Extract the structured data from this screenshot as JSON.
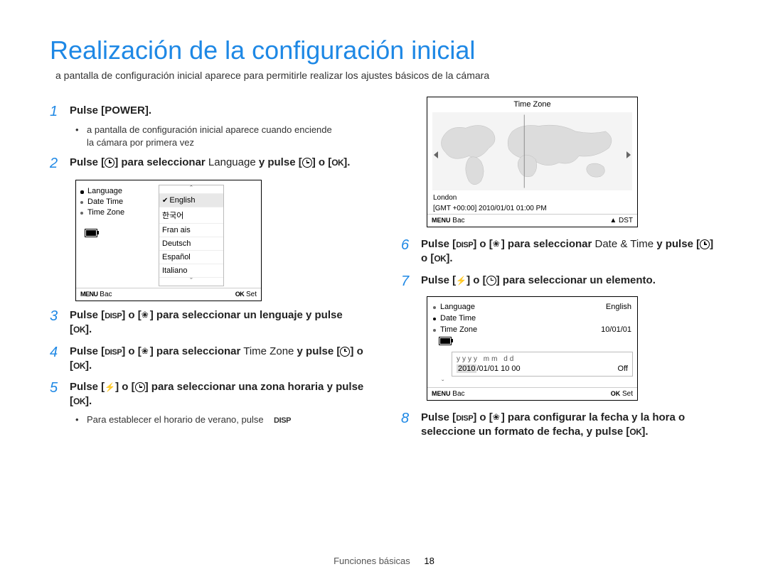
{
  "header": {
    "title": "Realización de la configuración inicial",
    "subtitle": "a pantalla de configuración inicial aparece para permitirle realizar los ajustes básicos de la cámara"
  },
  "steps": {
    "s1": {
      "pre": "Pulse [",
      "power": "POWER",
      "post": "].",
      "bullet_a": "a pantalla de configuración inicial aparece cuando enciende",
      "bullet_b": "la cámara por primera vez"
    },
    "s2": {
      "p1": "Pulse [",
      "p2": "] para seleccionar",
      "lang": " Language ",
      "p3": "y pulse [",
      "p4": "] o [",
      "p5": "]."
    },
    "s3": {
      "p1": "Pulse [",
      "p2": "] o [",
      "p3": "] para seleccionar un lenguaje y pulse [",
      "p4": "]."
    },
    "s4": {
      "p1": "Pulse [",
      "p2": "] o [",
      "p3": "] para seleccionar",
      "tz": " Time Zone ",
      "p4": "y pulse [",
      "p5": "] o [",
      "p6": "]."
    },
    "s5": {
      "p1": "Pulse [",
      "p2": "] o [",
      "p3": "] para seleccionar una zona horaria y pulse [",
      "p4": "].",
      "bullet": "Para establecer el horario de verano, pulse"
    },
    "s6": {
      "p1": "Pulse [",
      "p2": "] o [",
      "p3": "] para seleccionar",
      "dt": " Date & Time ",
      "p4": "y pulse [",
      "p5": "] o [",
      "p6": "]."
    },
    "s7": {
      "p1": "Pulse [",
      "p2": "] o [",
      "p3": "] para seleccionar un elemento."
    },
    "s8": {
      "p1": "Pulse [",
      "p2": "] o [",
      "p3": "] para configurar la fecha y la hora o seleccione un formato de fecha, y pulse [",
      "p4": "]."
    }
  },
  "glyphs": {
    "disp": "DISP",
    "ok": "OK",
    "menu": "MENU",
    "up": "▲",
    "dn": "▼"
  },
  "lcd_lang": {
    "left": {
      "item1": "Language",
      "item2": "Date   Time",
      "item3": "Time Zone"
    },
    "list": {
      "l1": "English",
      "l2": "한국어",
      "l3": "Fran ais",
      "l4": "Deutsch",
      "l5": "Español",
      "l6": "Italiano"
    },
    "bar_back": "Bac",
    "bar_set": "Set"
  },
  "lcd_tz": {
    "title": "Time Zone",
    "city": "London",
    "stamp": "[GMT +00:00] 2010/01/01 01:00 PM",
    "bar_back": "Bac",
    "bar_dst": "DST"
  },
  "lcd_dt": {
    "r1_l": "Language",
    "r1_r": "English",
    "r2_l": "Date   Time",
    "r2_r": "",
    "r3_l": "Time Zone",
    "r3_r": "10/01/01",
    "fmt": "yyyy   mm   dd",
    "val_hl": "2010",
    "val_rest": "/01/01 10 00",
    "val_off": "Off",
    "bar_back": "Bac",
    "bar_set": "Set"
  },
  "footer": {
    "section": "Funciones básicas",
    "page": "18"
  }
}
